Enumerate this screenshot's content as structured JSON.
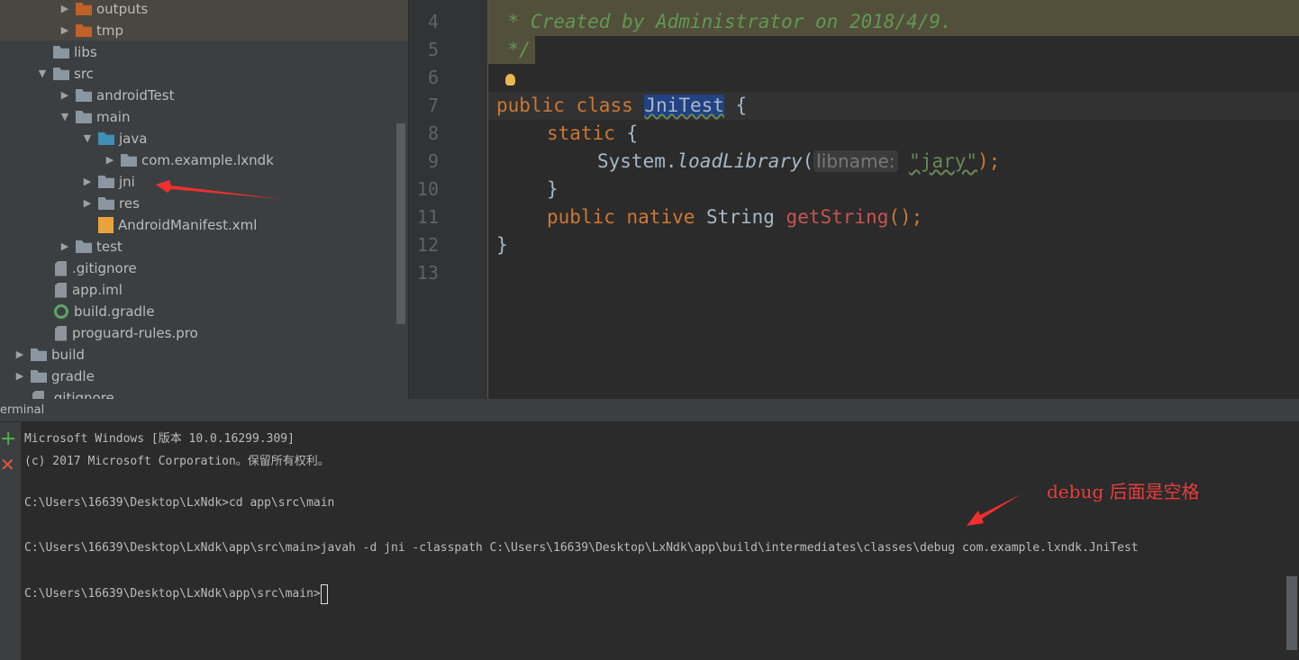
{
  "project_tree": {
    "items": [
      {
        "label": "outputs",
        "depth": 2,
        "expand": "collapsed",
        "icon": "folder-orange-icon",
        "highlighted": true
      },
      {
        "label": "tmp",
        "depth": 2,
        "expand": "collapsed",
        "icon": "folder-orange-icon",
        "highlighted": true
      },
      {
        "label": "libs",
        "depth": 1,
        "expand": "none",
        "icon": "folder-icon"
      },
      {
        "label": "src",
        "depth": 1,
        "expand": "expanded",
        "icon": "folder-icon"
      },
      {
        "label": "androidTest",
        "depth": 2,
        "expand": "collapsed",
        "icon": "folder-icon"
      },
      {
        "label": "main",
        "depth": 2,
        "expand": "expanded",
        "icon": "folder-icon"
      },
      {
        "label": "java",
        "depth": 3,
        "expand": "expanded",
        "icon": "folder-blue-icon"
      },
      {
        "label": "com.example.lxndk",
        "depth": 4,
        "expand": "collapsed",
        "icon": "package-icon"
      },
      {
        "label": "jni",
        "depth": 3,
        "expand": "collapsed",
        "icon": "folder-icon"
      },
      {
        "label": "res",
        "depth": 3,
        "expand": "collapsed",
        "icon": "res-folder-icon"
      },
      {
        "label": "AndroidManifest.xml",
        "depth": 3,
        "expand": "none",
        "icon": "manifest-icon"
      },
      {
        "label": "test",
        "depth": 2,
        "expand": "collapsed",
        "icon": "folder-icon"
      },
      {
        "label": ".gitignore",
        "depth": 1,
        "expand": "none",
        "icon": "file-icon"
      },
      {
        "label": "app.iml",
        "depth": 1,
        "expand": "none",
        "icon": "module-icon"
      },
      {
        "label": "build.gradle",
        "depth": 1,
        "expand": "none",
        "icon": "gradle-icon"
      },
      {
        "label": "proguard-rules.pro",
        "depth": 1,
        "expand": "none",
        "icon": "file-icon"
      },
      {
        "label": "build",
        "depth": 0,
        "expand": "collapsed",
        "icon": "folder-icon"
      },
      {
        "label": "gradle",
        "depth": 0,
        "expand": "collapsed",
        "icon": "folder-icon"
      },
      {
        "label": ".gitignore",
        "depth": 0,
        "expand": "none",
        "icon": "file-icon"
      }
    ]
  },
  "editor": {
    "line_numbers": [
      "4",
      "5",
      "6",
      "7",
      "8",
      "9",
      "10",
      "11",
      "12",
      "13"
    ],
    "code": {
      "l4": " * Created by Administrator on 2018/4/9.",
      "l5": " */",
      "public": "public",
      "class": "class",
      "classname": "JniTest",
      "brace_open": " {",
      "static": "static",
      "static_brace": " {",
      "system": "System.",
      "loadlib": "loadLibrary",
      "paren_open": "(",
      "hint": "libname:",
      "str": "\"jary\"",
      "paren_close": ");",
      "close_inner": "}",
      "native": "native",
      "string_type": "String",
      "method": "getString",
      "method_tail": "();",
      "close_outer": "}"
    }
  },
  "terminal": {
    "title": "erminal",
    "lines": [
      "Microsoft Windows [版本 10.0.16299.309]",
      "(c) 2017 Microsoft Corporation。保留所有权利。",
      "C:\\Users\\16639\\Desktop\\LxNdk>cd app\\src\\main",
      "C:\\Users\\16639\\Desktop\\LxNdk\\app\\src\\main>javah -d jni -classpath C:\\Users\\16639\\Desktop\\LxNdk\\app\\build\\intermediates\\classes\\debug com.example.lxndk.JniTest",
      "C:\\Users\\16639\\Desktop\\LxNdk\\app\\src\\main>"
    ],
    "annotation": "debug 后面是空格"
  },
  "colors": {
    "annotation": "#e83c3c",
    "keyword": "#cc7832",
    "comment": "#629755",
    "method": "#c75450"
  }
}
